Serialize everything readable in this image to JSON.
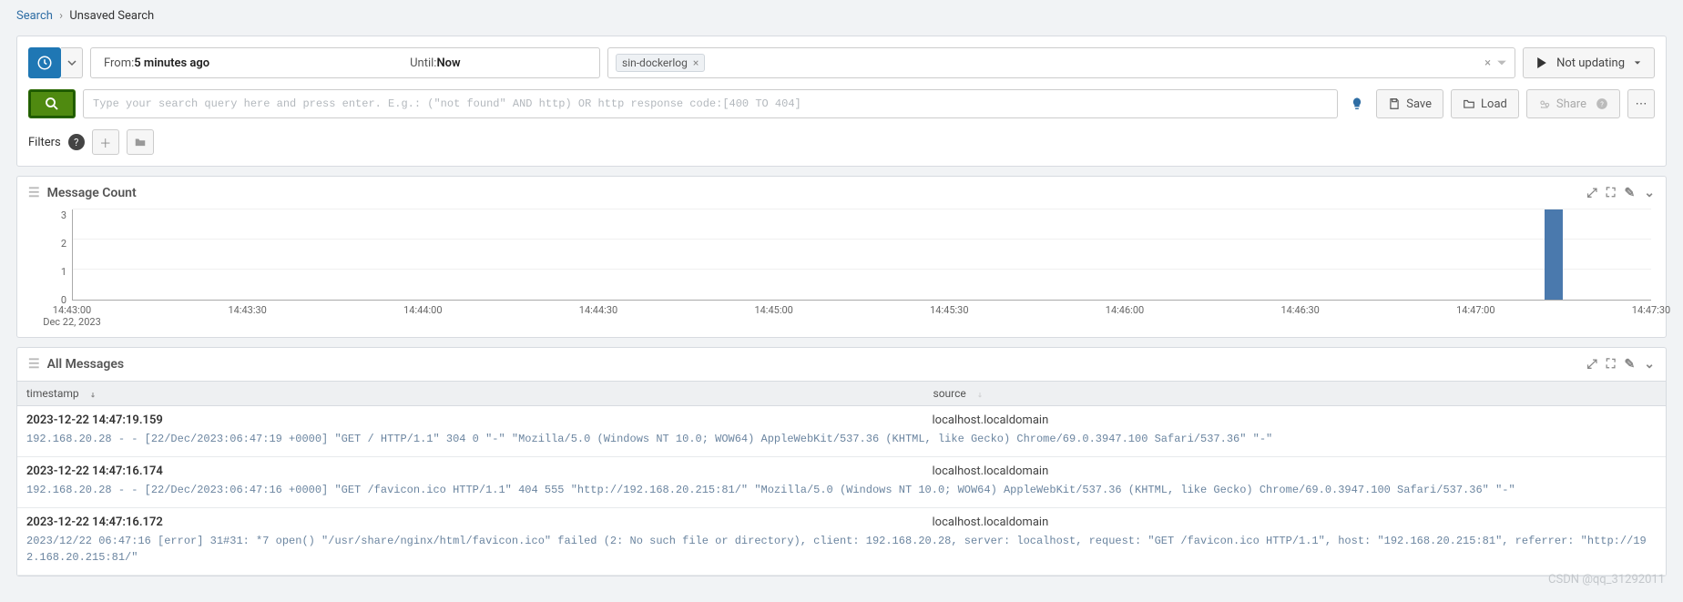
{
  "breadcrumbs": {
    "root": "Search",
    "current": "Unsaved Search"
  },
  "time": {
    "from_label": "From: ",
    "from_value": "5 minutes ago",
    "until_label": "Until: ",
    "until_value": "Now"
  },
  "stream_chip": "sin-dockerlog",
  "updating_label": "Not updating",
  "query_placeholder": "Type your search query here and press enter. E.g.: (\"not found\" AND http) OR http response code:[400 TO 404]",
  "buttons": {
    "save": "Save",
    "load": "Load",
    "share": "Share"
  },
  "filters_label": "Filters",
  "panels": {
    "count_title": "Message Count",
    "messages_title": "All Messages"
  },
  "chart_data": {
    "type": "bar",
    "title": "Message Count",
    "xlabel": "",
    "ylabel": "",
    "ylim": [
      0,
      3
    ],
    "yticks": [
      0,
      1,
      2,
      3
    ],
    "categories": [
      "14:43:00",
      "14:43:30",
      "14:44:00",
      "14:44:30",
      "14:45:00",
      "14:45:30",
      "14:46:00",
      "14:46:30",
      "14:47:00",
      "14:47:30"
    ],
    "date_sub": "Dec 22, 2023",
    "values": [
      0,
      0,
      0,
      0,
      0,
      0,
      0,
      0,
      3,
      0
    ],
    "bar": {
      "index_fraction": 0.938,
      "value": 3
    }
  },
  "table": {
    "columns": {
      "timestamp": "timestamp",
      "source": "source"
    },
    "rows": [
      {
        "timestamp": "2023-12-22 14:47:19.159",
        "source": "localhost.localdomain",
        "message": "192.168.20.28 - - [22/Dec/2023:06:47:19 +0000] \"GET / HTTP/1.1\" 304 0 \"-\" \"Mozilla/5.0 (Windows NT 10.0; WOW64) AppleWebKit/537.36 (KHTML, like Gecko) Chrome/69.0.3947.100 Safari/537.36\" \"-\""
      },
      {
        "timestamp": "2023-12-22 14:47:16.174",
        "source": "localhost.localdomain",
        "message": "192.168.20.28 - - [22/Dec/2023:06:47:16 +0000] \"GET /favicon.ico HTTP/1.1\" 404 555 \"http://192.168.20.215:81/\" \"Mozilla/5.0 (Windows NT 10.0; WOW64) AppleWebKit/537.36 (KHTML, like Gecko) Chrome/69.0.3947.100 Safari/537.36\" \"-\""
      },
      {
        "timestamp": "2023-12-22 14:47:16.172",
        "source": "localhost.localdomain",
        "message": "2023/12/22 06:47:16 [error] 31#31: *7 open() \"/usr/share/nginx/html/favicon.ico\" failed (2: No such file or directory), client: 192.168.20.28, server: localhost, request: \"GET /favicon.ico HTTP/1.1\", host: \"192.168.20.215:81\", referrer: \"http://192.168.20.215:81/\""
      }
    ]
  },
  "watermark": "CSDN @qq_31292011"
}
